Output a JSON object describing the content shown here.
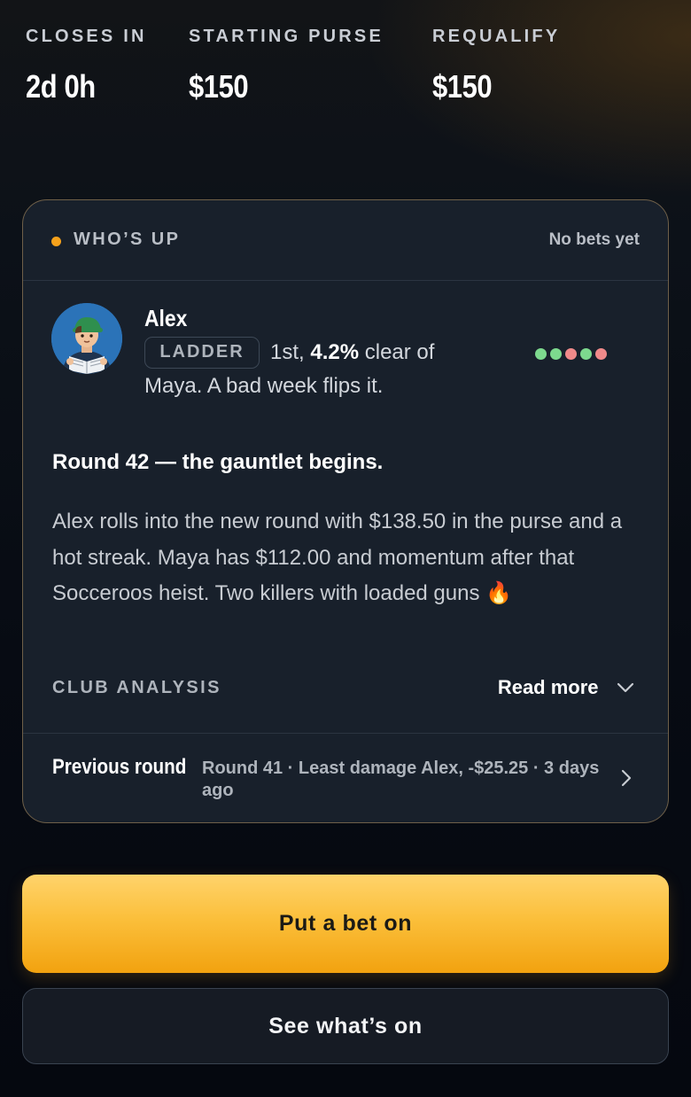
{
  "stats": [
    {
      "label": "CLOSES IN",
      "value": "2d 0h"
    },
    {
      "label": "STARTING PURSE",
      "value": "$150"
    },
    {
      "label": "REQUALIFY",
      "value": "$150"
    }
  ],
  "card": {
    "header_label": "WHO’S UP",
    "header_status": "No bets yet",
    "player": {
      "name": "Alex",
      "badge": "LADDER",
      "rank_prefix": "1st, ",
      "rank_margin": "4.2%",
      "rank_suffix": " clear of",
      "rank_line2": "Maya. A bad week flips it.",
      "form": [
        "win",
        "win",
        "loss",
        "win",
        "loss"
      ]
    },
    "story_title": "Round 42 — the gauntlet begins.",
    "story_body": "Alex rolls into the new round with $138.50 in the purse and a hot streak. Maya has $112.00 and momentum after that Socceroos heist. Two killers with loaded guns",
    "story_emoji": "🔥",
    "analysis_label": "CLUB ANALYSIS",
    "read_more": "Read more",
    "previous_round": {
      "label": "Previous round",
      "description": "Round 41 · Least damage Alex, -$25.25 · 3 days ago"
    }
  },
  "buttons": {
    "primary": "Put a bet on",
    "secondary": "See what’s on"
  },
  "colors": {
    "accent": "#f5a11b",
    "win": "#7dd98e",
    "loss": "#f08a8a"
  },
  "icons": {
    "status_dot": "dot-icon",
    "read_more": "chevron-down-icon",
    "previous_round": "chevron-right-icon",
    "flame": "fire-icon"
  }
}
